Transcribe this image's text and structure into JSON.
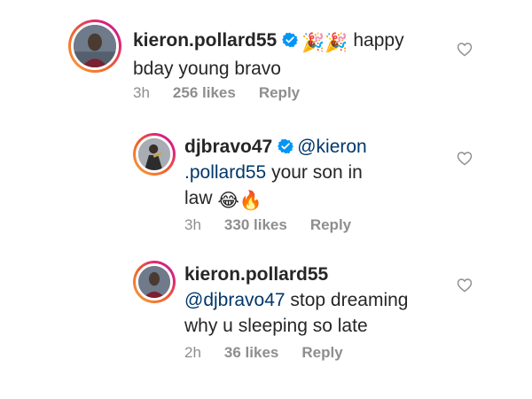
{
  "comments": [
    {
      "username": "kieron.pollard55",
      "verified": true,
      "emojis": "🎉🎉",
      "text_parts": [
        "happy",
        "bday young bravo"
      ],
      "time": "3h",
      "likes": "256 likes",
      "reply": "Reply"
    },
    {
      "username": "djbravo47",
      "verified": true,
      "mention_parts": [
        "@kieron",
        ".pollard55"
      ],
      "text_parts": [
        "your son in",
        "law"
      ],
      "emojis": "😂🔥",
      "time": "3h",
      "likes": "330 likes",
      "reply": "Reply"
    },
    {
      "username": "kieron.pollard55",
      "verified": false,
      "mention": "@djbravo47",
      "text_parts": [
        "stop dreaming",
        "why u sleeping so late"
      ],
      "time": "2h",
      "likes": "36 likes",
      "reply": "Reply"
    }
  ],
  "colors": {
    "text": "#262626",
    "mention": "#00376b",
    "meta": "#8e8e8e",
    "verified": "#0095f6"
  },
  "icons": {
    "verified": "verified-badge-icon",
    "like": "heart-outline-icon"
  }
}
